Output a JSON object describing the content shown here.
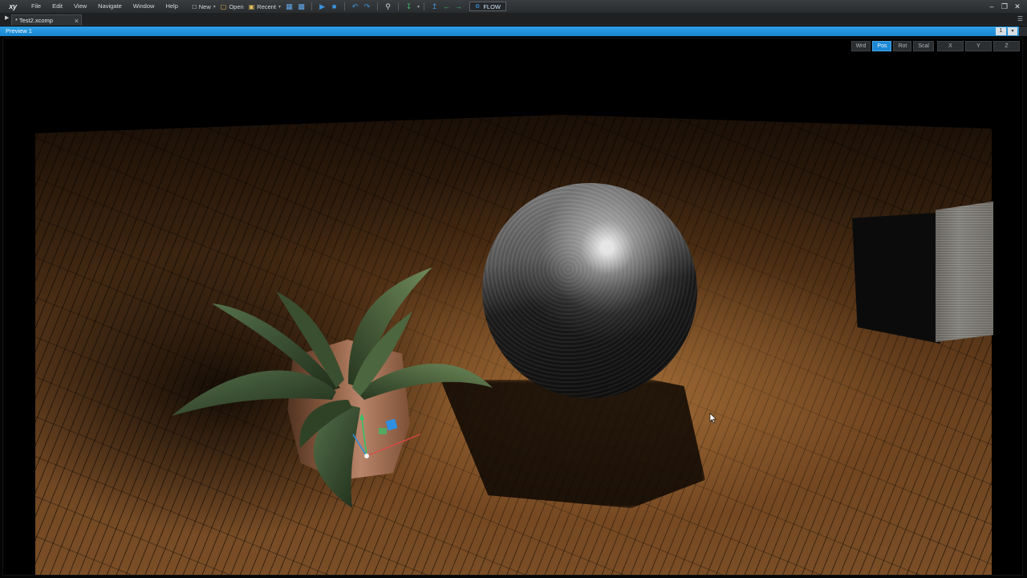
{
  "app": {
    "logo": "xy"
  },
  "menu": {
    "file": "File",
    "edit": "Edit",
    "view": "View",
    "navigate": "Navigate",
    "window": "Window",
    "help": "Help"
  },
  "toolbar": {
    "new": "New",
    "open": "Open",
    "recent": "Recent",
    "flow": "FLOW"
  },
  "tabs": {
    "document": "* Test2.xcomp"
  },
  "preview": {
    "title": "Preview 1",
    "number": "1"
  },
  "transform": {
    "world": "Wrd",
    "position": "Pos",
    "rotation": "Rot",
    "scale": "Scal",
    "active": "Pos"
  },
  "axes": {
    "x": "X",
    "y": "Y",
    "z": "Z"
  },
  "colors": {
    "accent": "#1c88d3",
    "preview_bar": "#2ea0e6",
    "gizmo_x": "#e64646",
    "gizmo_y": "#35c36a",
    "gizmo_z": "#2f8fe0"
  }
}
